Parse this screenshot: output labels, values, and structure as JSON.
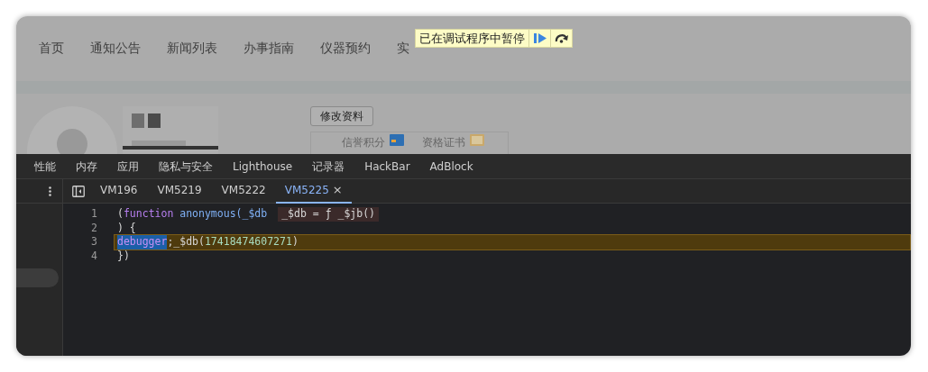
{
  "web_page": {
    "nav": [
      "首页",
      "通知公告",
      "新闻列表",
      "办事指南",
      "仪器预约",
      "实"
    ],
    "profile": {
      "edit_button": "修改资料",
      "stats": [
        {
          "label": "信誉积分"
        },
        {
          "label": "资格证书"
        }
      ]
    }
  },
  "paused_banner": {
    "text": "已在调试程序中暂停"
  },
  "devtools": {
    "panels": [
      "性能",
      "内存",
      "应用",
      "隐私与安全",
      "Lighthouse",
      "记录器",
      "HackBar",
      "AdBlock"
    ],
    "editor_tabs": [
      {
        "label": "VM196",
        "selected": false
      },
      {
        "label": "VM5219",
        "selected": false
      },
      {
        "label": "VM5222",
        "selected": false
      },
      {
        "label": "VM5225",
        "selected": true,
        "close": "×"
      }
    ],
    "code": [
      {
        "number": "1",
        "current": false,
        "tokens": [
          {
            "text": "(",
            "kind": "punct"
          },
          {
            "text": "function",
            "kind": "keyword"
          },
          {
            "text": " anonymous(_$db",
            "kind": "name"
          }
        ],
        "inline_value": "_$db = ƒ _$jb()"
      },
      {
        "number": "2",
        "current": false,
        "tokens": [
          {
            "text": ") {",
            "kind": "punct"
          }
        ]
      },
      {
        "number": "3",
        "current": true,
        "tokens": [
          {
            "text": "debugger",
            "kind": "selected"
          },
          {
            "text": ";_$db(",
            "kind": "punct"
          },
          {
            "text": "17418474607271",
            "kind": "number"
          },
          {
            "text": ")",
            "kind": "punct"
          }
        ]
      },
      {
        "number": "4",
        "current": false,
        "tokens": [
          {
            "text": "})",
            "kind": "punct"
          }
        ]
      }
    ]
  }
}
